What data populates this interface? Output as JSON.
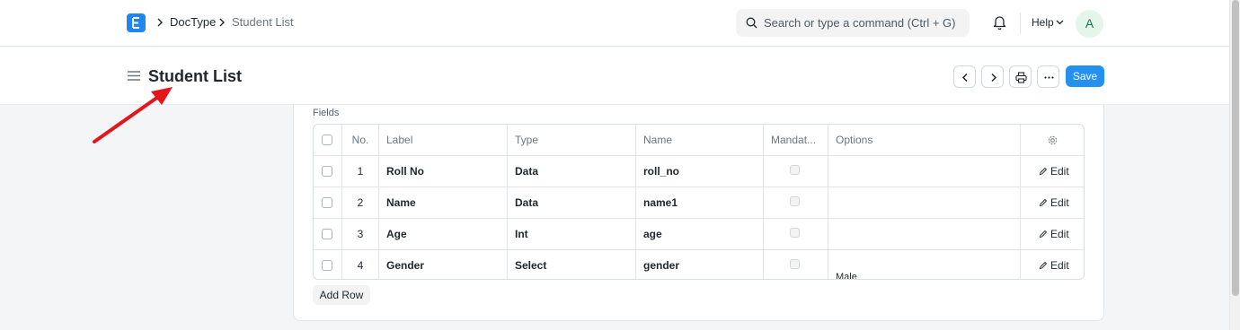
{
  "navbar": {
    "breadcrumbs": [
      "DocType",
      "Student List"
    ],
    "search_placeholder": "Search or type a command (Ctrl + G)",
    "help_label": "Help",
    "avatar_initial": "A"
  },
  "page": {
    "title": "Student List",
    "save_label": "Save"
  },
  "form": {
    "section_label": "Fields",
    "columns": [
      "No.",
      "Label",
      "Type",
      "Name",
      "Mandat...",
      "Options"
    ],
    "rows": [
      {
        "no": "1",
        "label": "Roll No",
        "type": "Data",
        "name": "roll_no",
        "options": "",
        "edit": "Edit"
      },
      {
        "no": "2",
        "label": "Name",
        "type": "Data",
        "name": "name1",
        "options": "",
        "edit": "Edit"
      },
      {
        "no": "3",
        "label": "Age",
        "type": "Int",
        "name": "age",
        "options": "",
        "edit": "Edit"
      },
      {
        "no": "4",
        "label": "Gender",
        "type": "Select",
        "name": "gender",
        "options": "Male",
        "edit": "Edit"
      }
    ],
    "add_row_label": "Add Row"
  },
  "colors": {
    "primary": "#2490ef",
    "annotation_arrow": "#e3161b"
  }
}
